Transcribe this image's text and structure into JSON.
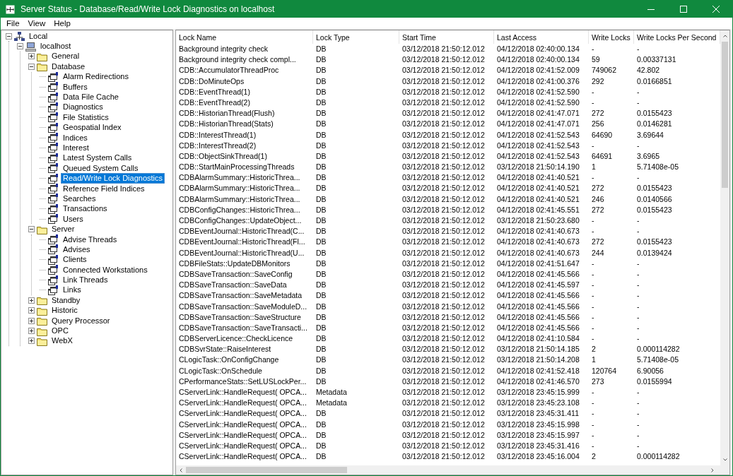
{
  "window": {
    "title": "Server Status - Database/Read/Write Lock Diagnostics on localhost"
  },
  "menu": [
    "File",
    "View",
    "Help"
  ],
  "tree": [
    {
      "label": "Local",
      "kind": "network",
      "expanded": true,
      "selected": false,
      "children": [
        {
          "label": "localhost",
          "kind": "computer",
          "expanded": true,
          "selected": false,
          "children": [
            {
              "label": "General",
              "kind": "folder",
              "expanded": false,
              "selected": false
            },
            {
              "label": "Database",
              "kind": "folder",
              "expanded": true,
              "selected": false,
              "children": [
                {
                  "label": "Alarm Redirections",
                  "kind": "page",
                  "selected": false
                },
                {
                  "label": "Buffers",
                  "kind": "page",
                  "selected": false
                },
                {
                  "label": "Data File Cache",
                  "kind": "page",
                  "selected": false
                },
                {
                  "label": "Diagnostics",
                  "kind": "page",
                  "selected": false
                },
                {
                  "label": "File Statistics",
                  "kind": "page",
                  "selected": false
                },
                {
                  "label": "Geospatial Index",
                  "kind": "page",
                  "selected": false
                },
                {
                  "label": "Indices",
                  "kind": "page",
                  "selected": false
                },
                {
                  "label": "Interest",
                  "kind": "page",
                  "selected": false
                },
                {
                  "label": "Latest System Calls",
                  "kind": "page",
                  "selected": false
                },
                {
                  "label": "Queued System Calls",
                  "kind": "page",
                  "selected": false
                },
                {
                  "label": "Read/Write Lock Diagnostics",
                  "kind": "page",
                  "selected": true
                },
                {
                  "label": "Reference Field Indices",
                  "kind": "page",
                  "selected": false
                },
                {
                  "label": "Searches",
                  "kind": "page",
                  "selected": false
                },
                {
                  "label": "Transactions",
                  "kind": "page",
                  "selected": false
                },
                {
                  "label": "Users",
                  "kind": "page",
                  "selected": false
                }
              ]
            },
            {
              "label": "Server",
              "kind": "folder",
              "expanded": true,
              "selected": false,
              "children": [
                {
                  "label": "Advise Threads",
                  "kind": "page",
                  "selected": false
                },
                {
                  "label": "Advises",
                  "kind": "page",
                  "selected": false
                },
                {
                  "label": "Clients",
                  "kind": "page",
                  "selected": false
                },
                {
                  "label": "Connected Workstations",
                  "kind": "page",
                  "selected": false
                },
                {
                  "label": "Link Threads",
                  "kind": "page",
                  "selected": false
                },
                {
                  "label": "Links",
                  "kind": "page",
                  "selected": false
                }
              ]
            },
            {
              "label": "Standby",
              "kind": "folder",
              "expanded": false,
              "selected": false
            },
            {
              "label": "Historic",
              "kind": "folder",
              "expanded": false,
              "selected": false
            },
            {
              "label": "Query Processor",
              "kind": "folder",
              "expanded": false,
              "selected": false
            },
            {
              "label": "OPC",
              "kind": "folder",
              "expanded": false,
              "selected": false
            },
            {
              "label": "WebX",
              "kind": "folder",
              "expanded": false,
              "selected": false
            }
          ]
        }
      ]
    }
  ],
  "table": {
    "columns": [
      "Lock Name",
      "Lock Type",
      "Start Time",
      "Last Access",
      "Write Locks",
      "Write Locks Per Second"
    ],
    "rows": [
      [
        "Background integrity check",
        "DB",
        "03/12/2018 21:50:12.012",
        "04/12/2018 02:40:00.134",
        "-",
        "-"
      ],
      [
        "Background integrity check compl...",
        "DB",
        "03/12/2018 21:50:12.012",
        "04/12/2018 02:40:00.134",
        "59",
        "0.00337131"
      ],
      [
        "CDB::AccumulatorThreadProc",
        "DB",
        "03/12/2018 21:50:12.012",
        "04/12/2018 02:41:52.009",
        "749062",
        "42.802"
      ],
      [
        "CDB::DoMinuteOps",
        "DB",
        "03/12/2018 21:50:12.012",
        "04/12/2018 02:41:00.376",
        "292",
        "0.0166851"
      ],
      [
        "CDB::EventThread(1)",
        "DB",
        "03/12/2018 21:50:12.012",
        "04/12/2018 02:41:52.590",
        "-",
        "-"
      ],
      [
        "CDB::EventThread(2)",
        "DB",
        "03/12/2018 21:50:12.012",
        "04/12/2018 02:41:52.590",
        "-",
        "-"
      ],
      [
        "CDB::HistorianThread(Flush)",
        "DB",
        "03/12/2018 21:50:12.012",
        "04/12/2018 02:41:47.071",
        "272",
        "0.0155423"
      ],
      [
        "CDB::HistorianThread(Stats)",
        "DB",
        "03/12/2018 21:50:12.012",
        "04/12/2018 02:41:47.071",
        "256",
        "0.0146281"
      ],
      [
        "CDB::InterestThread(1)",
        "DB",
        "03/12/2018 21:50:12.012",
        "04/12/2018 02:41:52.543",
        "64690",
        "3.69644"
      ],
      [
        "CDB::InterestThread(2)",
        "DB",
        "03/12/2018 21:50:12.012",
        "04/12/2018 02:41:52.543",
        "-",
        "-"
      ],
      [
        "CDB::ObjectSinkThread(1)",
        "DB",
        "03/12/2018 21:50:12.012",
        "04/12/2018 02:41:52.543",
        "64691",
        "3.6965"
      ],
      [
        "CDB::StartMainProcessingThreads",
        "DB",
        "03/12/2018 21:50:12.012",
        "03/12/2018 21:50:14.190",
        "1",
        "5.71408e-05"
      ],
      [
        "CDBAlarmSummary::HistoricThrea...",
        "DB",
        "03/12/2018 21:50:12.012",
        "04/12/2018 02:41:40.521",
        "-",
        "-"
      ],
      [
        "CDBAlarmSummary::HistoricThrea...",
        "DB",
        "03/12/2018 21:50:12.012",
        "04/12/2018 02:41:40.521",
        "272",
        "0.0155423"
      ],
      [
        "CDBAlarmSummary::HistoricThrea...",
        "DB",
        "03/12/2018 21:50:12.012",
        "04/12/2018 02:41:40.521",
        "246",
        "0.0140566"
      ],
      [
        "CDBConfigChanges::HistoricThrea...",
        "DB",
        "03/12/2018 21:50:12.012",
        "04/12/2018 02:41:45.551",
        "272",
        "0.0155423"
      ],
      [
        "CDBConfigChanges::UpdateObject...",
        "DB",
        "03/12/2018 21:50:12.012",
        "03/12/2018 21:50:23.680",
        "-",
        "-"
      ],
      [
        "CDBEventJournal::HistoricThread(C...",
        "DB",
        "03/12/2018 21:50:12.012",
        "04/12/2018 02:41:40.673",
        "-",
        "-"
      ],
      [
        "CDBEventJournal::HistoricThread(Fl...",
        "DB",
        "03/12/2018 21:50:12.012",
        "04/12/2018 02:41:40.673",
        "272",
        "0.0155423"
      ],
      [
        "CDBEventJournal::HistoricThread(U...",
        "DB",
        "03/12/2018 21:50:12.012",
        "04/12/2018 02:41:40.673",
        "244",
        "0.0139424"
      ],
      [
        "CDBFileStats::UpdateDBMonitors",
        "DB",
        "03/12/2018 21:50:12.012",
        "04/12/2018 02:41:51.647",
        "-",
        "-"
      ],
      [
        "CDBSaveTransaction::SaveConfig",
        "DB",
        "03/12/2018 21:50:12.012",
        "04/12/2018 02:41:45.566",
        "-",
        "-"
      ],
      [
        "CDBSaveTransaction::SaveData",
        "DB",
        "03/12/2018 21:50:12.012",
        "04/12/2018 02:41:45.597",
        "-",
        "-"
      ],
      [
        "CDBSaveTransaction::SaveMetadata",
        "DB",
        "03/12/2018 21:50:12.012",
        "04/12/2018 02:41:45.566",
        "-",
        "-"
      ],
      [
        "CDBSaveTransaction::SaveModuleD...",
        "DB",
        "03/12/2018 21:50:12.012",
        "04/12/2018 02:41:45.566",
        "-",
        "-"
      ],
      [
        "CDBSaveTransaction::SaveStructure",
        "DB",
        "03/12/2018 21:50:12.012",
        "04/12/2018 02:41:45.566",
        "-",
        "-"
      ],
      [
        "CDBSaveTransaction::SaveTransacti...",
        "DB",
        "03/12/2018 21:50:12.012",
        "04/12/2018 02:41:45.566",
        "-",
        "-"
      ],
      [
        "CDBServerLicence::CheckLicence",
        "DB",
        "03/12/2018 21:50:12.012",
        "04/12/2018 02:41:10.584",
        "-",
        "-"
      ],
      [
        "CDBSvrState::RaiseInterest",
        "DB",
        "03/12/2018 21:50:12.012",
        "03/12/2018 21:50:14.185",
        "2",
        "0.000114282"
      ],
      [
        "CLogicTask::OnConfigChange",
        "DB",
        "03/12/2018 21:50:12.012",
        "03/12/2018 21:50:14.208",
        "1",
        "5.71408e-05"
      ],
      [
        "CLogicTask::OnSchedule",
        "DB",
        "03/12/2018 21:50:12.012",
        "04/12/2018 02:41:52.418",
        "120764",
        "6.90056"
      ],
      [
        "CPerformanceStats::SetLUSLockPer...",
        "DB",
        "03/12/2018 21:50:12.012",
        "04/12/2018 02:41:46.570",
        "273",
        "0.0155994"
      ],
      [
        "CServerLink::HandleRequest( OPCA...",
        "Metadata",
        "03/12/2018 21:50:12.012",
        "03/12/2018 23:45:15.999",
        "-",
        "-"
      ],
      [
        "CServerLink::HandleRequest( OPCA...",
        "Metadata",
        "03/12/2018 21:50:12.012",
        "03/12/2018 23:45:23.108",
        "-",
        "-"
      ],
      [
        "CServerLink::HandleRequest( OPCA...",
        "DB",
        "03/12/2018 21:50:12.012",
        "03/12/2018 23:45:31.411",
        "-",
        "-"
      ],
      [
        "CServerLink::HandleRequest( OPCA...",
        "DB",
        "03/12/2018 21:50:12.012",
        "03/12/2018 23:45:15.998",
        "-",
        "-"
      ],
      [
        "CServerLink::HandleRequest( OPCA...",
        "DB",
        "03/12/2018 21:50:12.012",
        "03/12/2018 23:45:15.997",
        "-",
        "-"
      ],
      [
        "CServerLink::HandleRequest( OPCA...",
        "DB",
        "03/12/2018 21:50:12.012",
        "03/12/2018 23:45:31.416",
        "-",
        "-"
      ],
      [
        "CServerLink::HandleRequest( OPCA...",
        "DB",
        "03/12/2018 21:50:12.012",
        "03/12/2018 23:45:16.004",
        "2",
        "0.000114282"
      ]
    ]
  }
}
